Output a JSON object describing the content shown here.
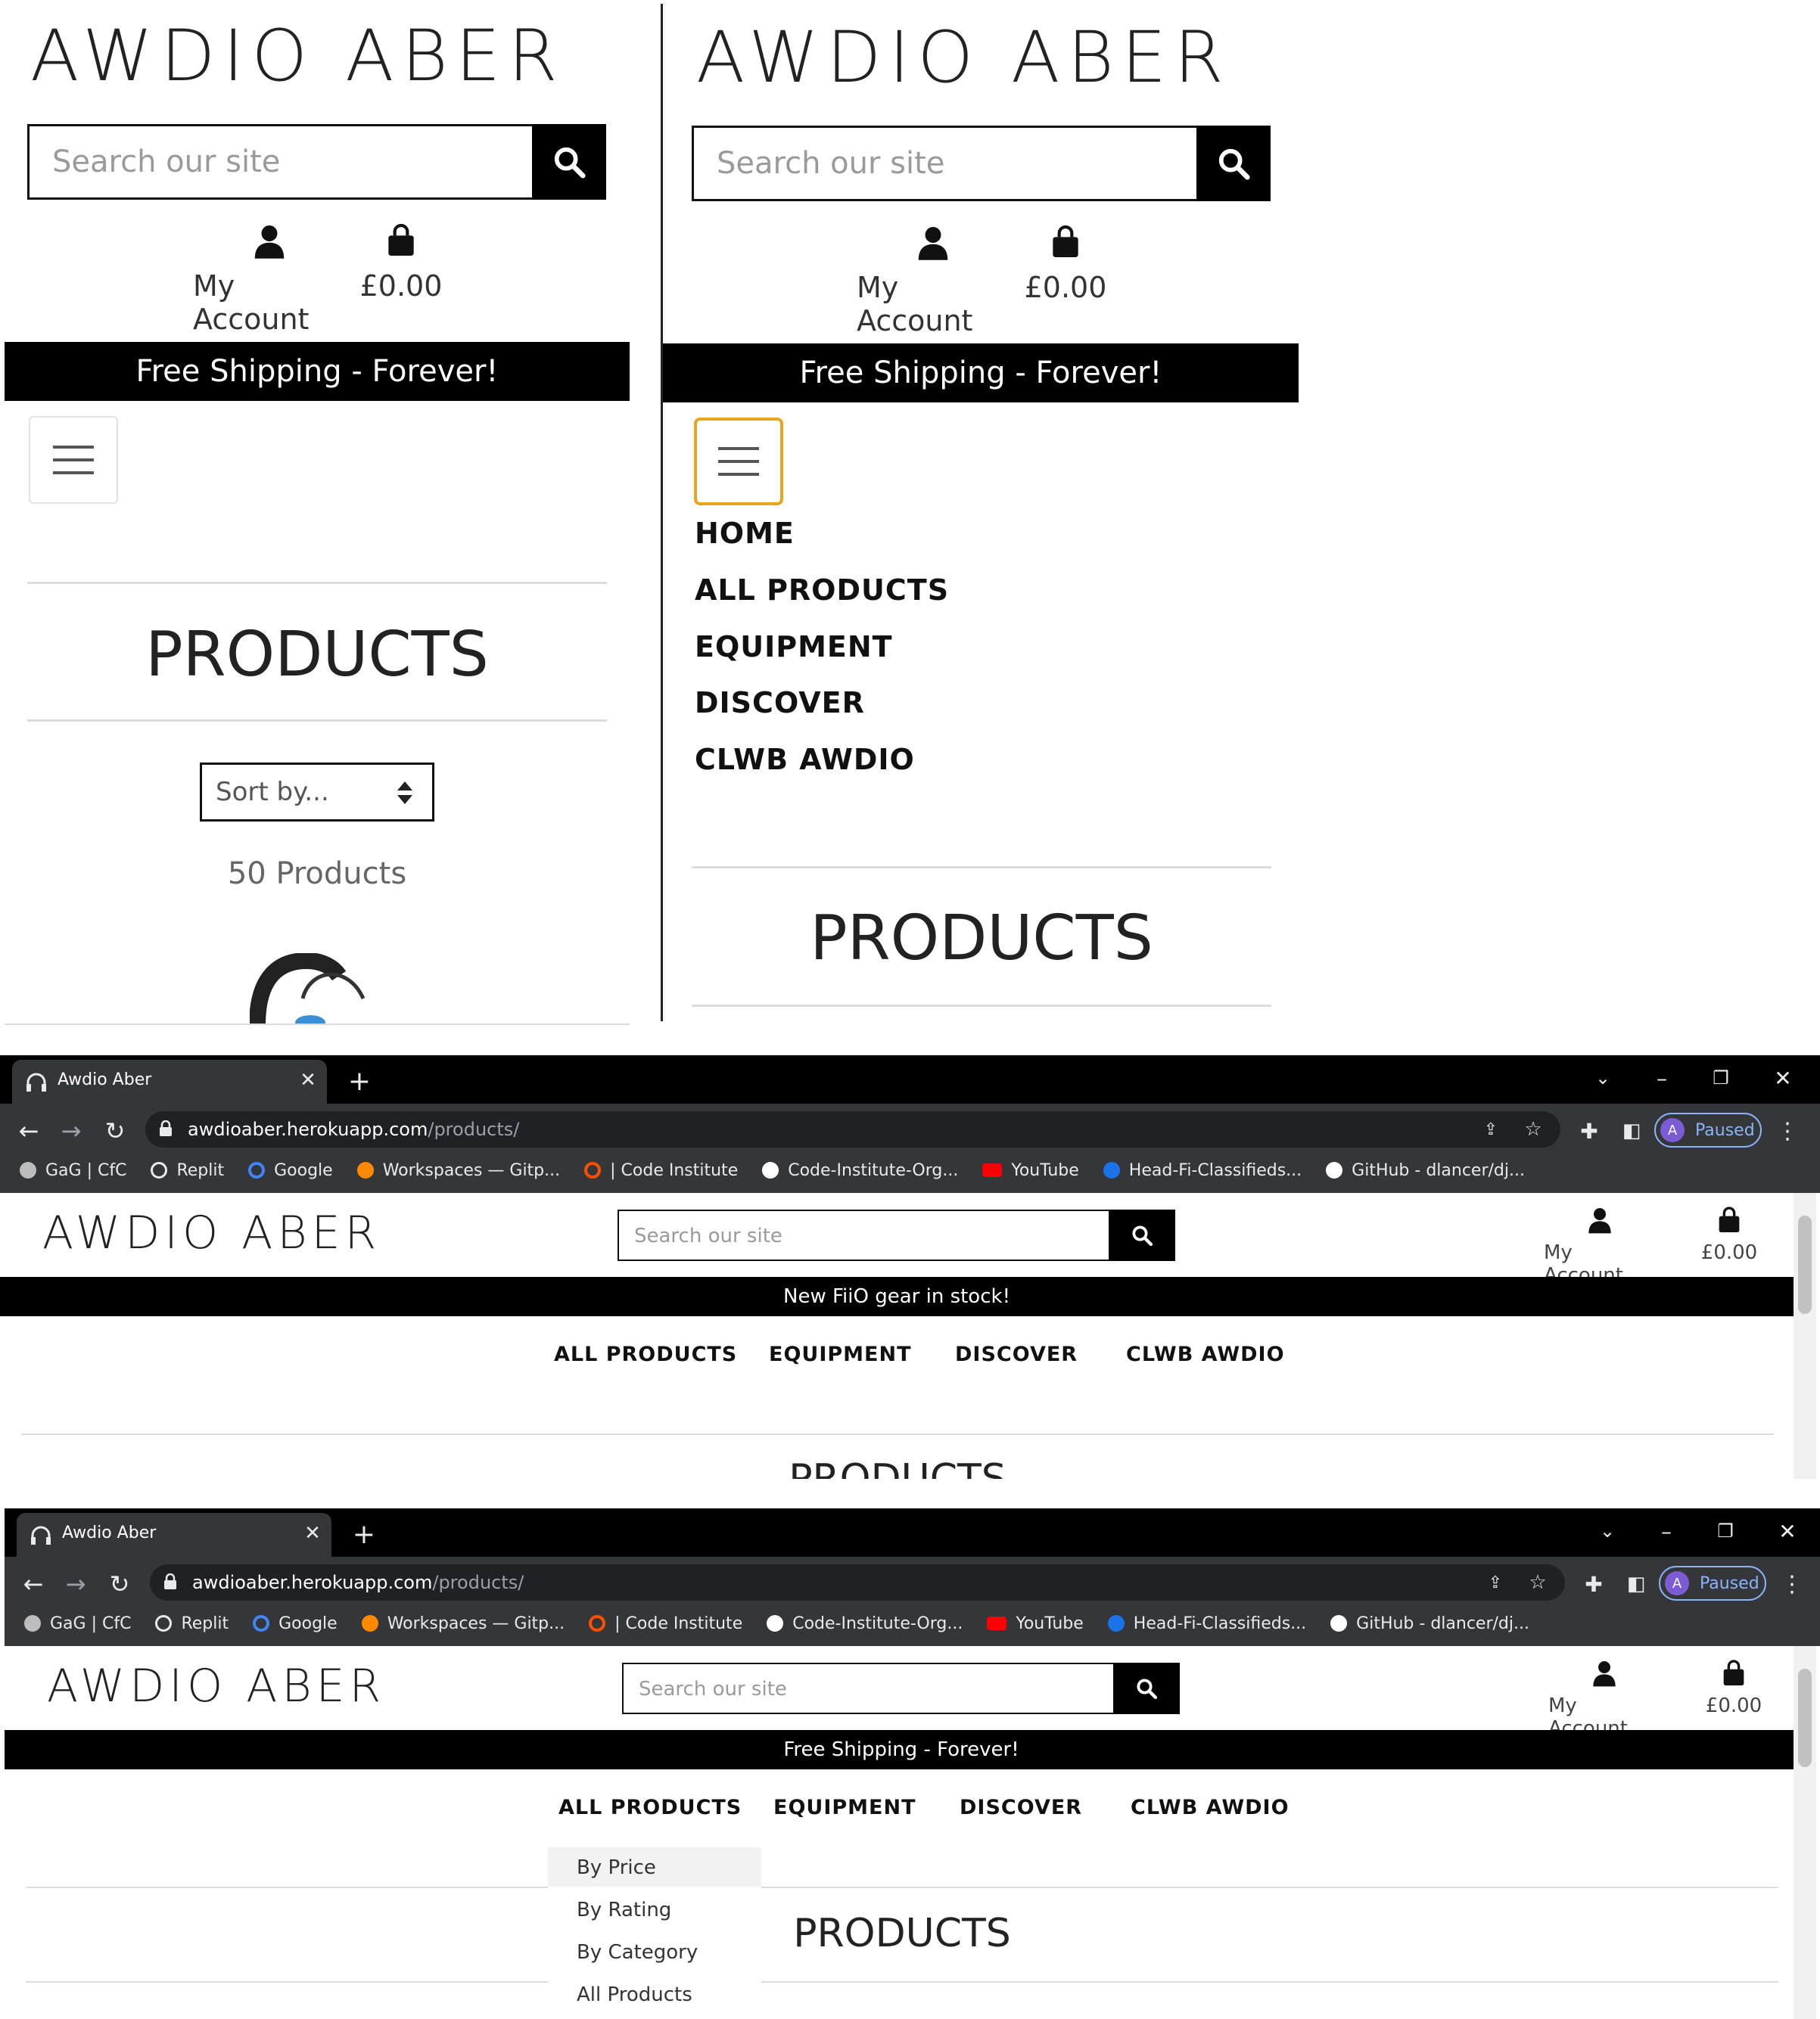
{
  "site": {
    "logo": "AWDIO ABER",
    "search_placeholder": "Search our site",
    "account_label": "My Account",
    "basket_total": "£0.00"
  },
  "mobile_left": {
    "banner": "Free Shipping - Forever!",
    "page_title": "PRODUCTS",
    "sort_label": "Sort by...",
    "product_count": "50 Products"
  },
  "mobile_right": {
    "banner": "Free Shipping - Forever!",
    "menu_items": [
      "HOME",
      "ALL PRODUCTS",
      "EQUIPMENT",
      "DISCOVER",
      "CLWB AWDIO"
    ],
    "page_title": "PRODUCTS"
  },
  "browser": {
    "tab_title": "Awdio Aber",
    "url_domain": "awdioaber.herokuapp.com",
    "url_path": "/products/",
    "profile_initial": "A",
    "profile_status": "Paused",
    "bookmarks": [
      {
        "label": "GaG | CfC",
        "icon": "globe-icon",
        "color": "#bdbdbd"
      },
      {
        "label": "Replit",
        "icon": "replit-icon",
        "color": "#e8eaed"
      },
      {
        "label": "Google",
        "icon": "google-icon",
        "color": "#4285f4"
      },
      {
        "label": "Workspaces — Gitp...",
        "icon": "gitpod-icon",
        "color": "#ff8a00"
      },
      {
        "label": "| Code Institute",
        "icon": "code-institute-icon",
        "color": "#ff4f00"
      },
      {
        "label": "Code-Institute-Org...",
        "icon": "github-icon",
        "color": "#ffffff"
      },
      {
        "label": "YouTube",
        "icon": "youtube-icon",
        "color": "#ff0000"
      },
      {
        "label": "Head-Fi-Classifieds...",
        "icon": "headfi-icon",
        "color": "#1a73e8"
      },
      {
        "label": "GitHub - dlancer/dj...",
        "icon": "github-icon",
        "color": "#ffffff"
      }
    ]
  },
  "desktop_top": {
    "banner": "New FiiO gear in stock!",
    "nav": [
      "ALL PRODUCTS",
      "EQUIPMENT",
      "DISCOVER",
      "CLWB AWDIO"
    ],
    "page_title_partial": "PRODUCTS"
  },
  "desktop_bottom": {
    "banner": "Free Shipping - Forever!",
    "nav": [
      "ALL PRODUCTS",
      "EQUIPMENT",
      "DISCOVER",
      "CLWB AWDIO"
    ],
    "dropdown": [
      "By Price",
      "By Rating",
      "By Category",
      "All Products"
    ],
    "page_title": "PRODUCTS"
  },
  "colors": {
    "menu_focus_outline": "#e8a320",
    "banner_bg": "#000000",
    "chrome_bg": "#35363a"
  }
}
